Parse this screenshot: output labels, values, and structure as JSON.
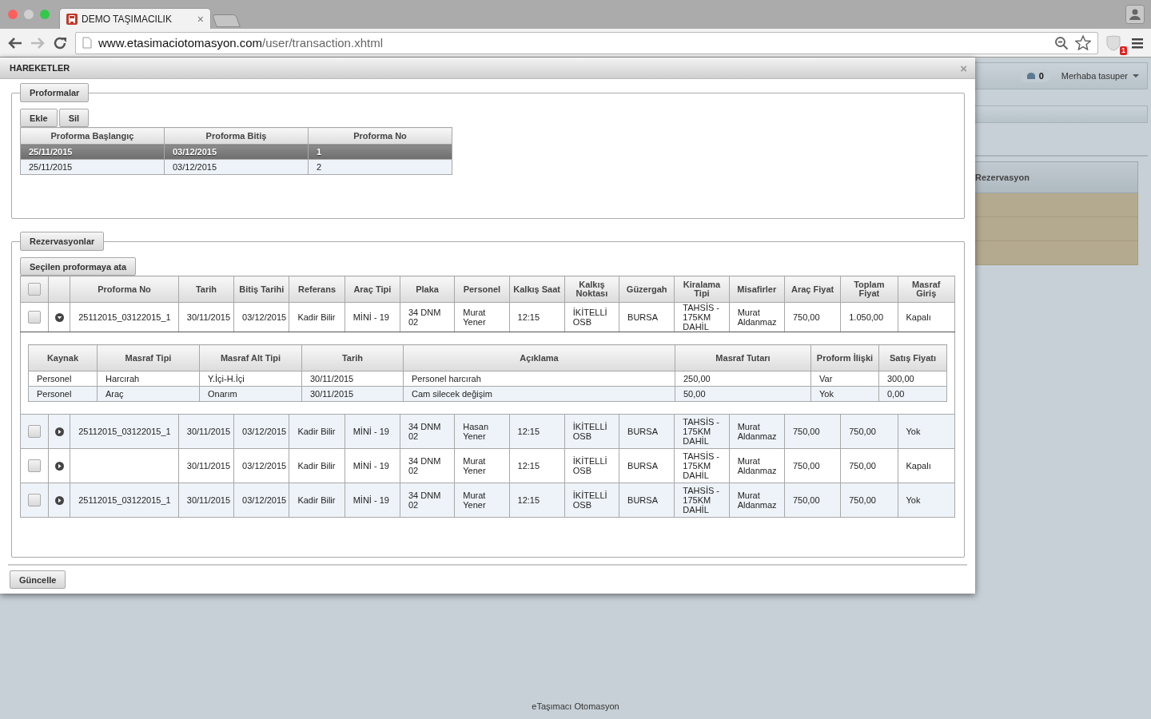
{
  "browser": {
    "tab_title": "DEMO TAŞIMACILIK",
    "tab_close": "×",
    "url_host": "www.etasimaciotomasyon.com",
    "url_path": "/user/transaction.xhtml",
    "extension_badge": "1"
  },
  "background_app": {
    "notification_count": "0",
    "user_menu": "Merhaba tasuper",
    "panel_title": "Rezervasyon"
  },
  "dialog": {
    "title": "HAREKETLER",
    "close": "×",
    "proformas": {
      "legend": "Proformalar",
      "buttons": [
        "Ekle",
        "Sil"
      ],
      "columns": [
        "Proforma Başlangıç",
        "Proforma Bitiş",
        "Proforma No"
      ],
      "rows": [
        {
          "start": "25/11/2015",
          "end": "03/12/2015",
          "no": "1",
          "selected": true
        },
        {
          "start": "25/11/2015",
          "end": "03/12/2015",
          "no": "2",
          "selected": false
        }
      ]
    },
    "reservations": {
      "legend": "Rezervasyonlar",
      "assign_button": "Seçilen proformaya ata",
      "select_all_checked": false,
      "columns": [
        "Proforma No",
        "Tarih",
        "Bitiş Tarihi",
        "Referans",
        "Araç Tipi",
        "Plaka",
        "Personel",
        "Kalkış Saat",
        "Kalkış Noktası",
        "Güzergah",
        "Kiralama Tipi",
        "Misafirler",
        "Araç Fiyat",
        "Toplam Fiyat",
        "Masraf Giriş"
      ],
      "rows": [
        {
          "checked": false,
          "expanded": true,
          "cells": [
            "25112015_03122015_1",
            "30/11/2015",
            "03/12/2015",
            "Kadir Bilir",
            "MİNİ - 19",
            "34 DNM 02",
            "Murat Yener",
            "12:15",
            "İKİTELLİ OSB",
            "BURSA",
            "TAHSİS - 175KM DAHİL",
            "Murat Aldanmaz",
            "750,00",
            "1.050,00",
            "Kapalı"
          ],
          "expense_columns": [
            "Kaynak",
            "Masraf Tipi",
            "Masraf Alt Tipi",
            "Tarih",
            "Açıklama",
            "Masraf Tutarı",
            "Proform İlişki",
            "Satış Fiyatı"
          ],
          "expenses": [
            [
              "Personel",
              "Harcırah",
              "Y.İçi-H.İçi",
              "30/11/2015",
              "Personel harcırah",
              "250,00",
              "Var",
              "300,00"
            ],
            [
              "Personel",
              "Araç",
              "Onarım",
              "30/11/2015",
              "Cam silecek değişim",
              "50,00",
              "Yok",
              "0,00"
            ]
          ]
        },
        {
          "checked": false,
          "expanded": false,
          "cells": [
            "25112015_03122015_1",
            "30/11/2015",
            "03/12/2015",
            "Kadir Bilir",
            "MİNİ - 19",
            "34 DNM 02",
            "Hasan Yener",
            "12:15",
            "İKİTELLİ OSB",
            "BURSA",
            "TAHSİS - 175KM DAHİL",
            "Murat Aldanmaz",
            "750,00",
            "750,00",
            "Yok"
          ]
        },
        {
          "checked": false,
          "expanded": false,
          "cells": [
            null,
            "30/11/2015",
            "03/12/2015",
            "Kadir Bilir",
            "MİNİ - 19",
            "34 DNM 02",
            "Murat Yener",
            "12:15",
            "İKİTELLİ OSB",
            "BURSA",
            "TAHSİS - 175KM DAHİL",
            "Murat Aldanmaz",
            "750,00",
            "750,00",
            "Kapalı"
          ]
        },
        {
          "checked": false,
          "expanded": false,
          "cells": [
            "25112015_03122015_1",
            "30/11/2015",
            "03/12/2015",
            "Kadir Bilir",
            "MİNİ - 19",
            "34 DNM 02",
            "Murat Yener",
            "12:15",
            "İKİTELLİ OSB",
            "BURSA",
            "TAHSİS - 175KM DAHİL",
            "Murat Aldanmaz",
            "750,00",
            "750,00",
            "Yok"
          ]
        }
      ]
    },
    "update_button": "Güncelle"
  },
  "footer": "eTaşımacı Otomasyon"
}
